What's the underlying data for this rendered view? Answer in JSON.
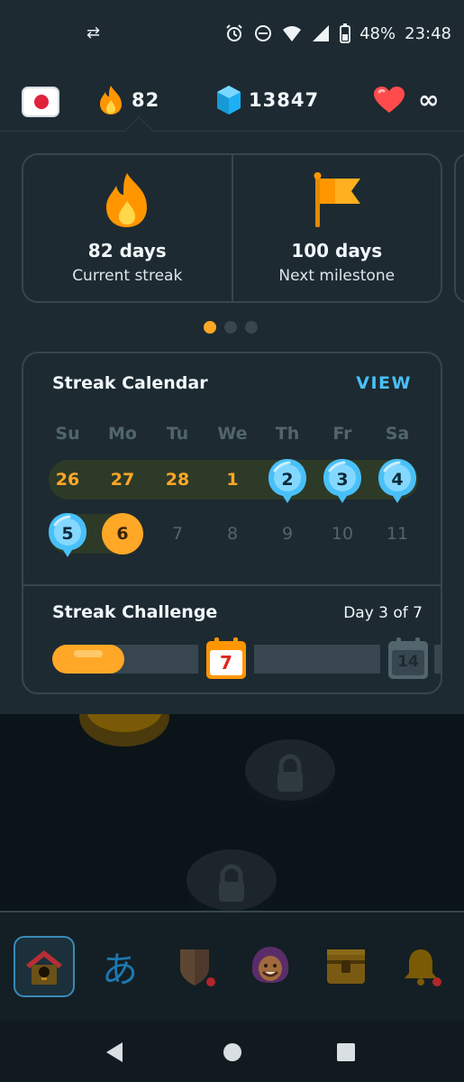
{
  "status_bar": {
    "battery": "48%",
    "time": "23:48",
    "icons": [
      "data-sync-icon",
      "alarm-icon",
      "do-not-disturb-icon",
      "wifi-icon",
      "signal-icon",
      "battery-icon"
    ]
  },
  "header": {
    "course_flag": "japan-flag-icon",
    "streak_count": "82",
    "gems_count": "13847",
    "hearts_value": "∞"
  },
  "streak_cards": [
    {
      "value": "82 days",
      "label": "Current streak",
      "icon": "flame-icon"
    },
    {
      "value": "100 days",
      "label": "Next milestone",
      "icon": "flag-icon"
    }
  ],
  "pager": {
    "count": 3,
    "active": 1
  },
  "calendar": {
    "title": "Streak Calendar",
    "view_label": "VIEW",
    "weekdays": [
      "Su",
      "Mo",
      "Tu",
      "We",
      "Th",
      "Fr",
      "Sa"
    ],
    "week1": [
      "26",
      "27",
      "28",
      "1",
      "2",
      "3",
      "4"
    ],
    "week2": [
      "5",
      "6",
      "7",
      "8",
      "9",
      "10",
      "11"
    ]
  },
  "challenge": {
    "title": "Streak Challenge",
    "progress_label": "Day 3 of 7",
    "milestone_current": "7",
    "milestone_next": "14"
  },
  "colors": {
    "accent_orange": "#ffa726",
    "accent_blue": "#49c0f8",
    "panel_bg": "#1d2a31",
    "border": "#37464f"
  },
  "bottom_nav": {
    "items": [
      "home-icon",
      "characters-icon",
      "leagues-shield-icon",
      "profile-avatar-icon",
      "treasure-chest-icon",
      "notifications-bell-icon"
    ],
    "kana": "あ"
  }
}
